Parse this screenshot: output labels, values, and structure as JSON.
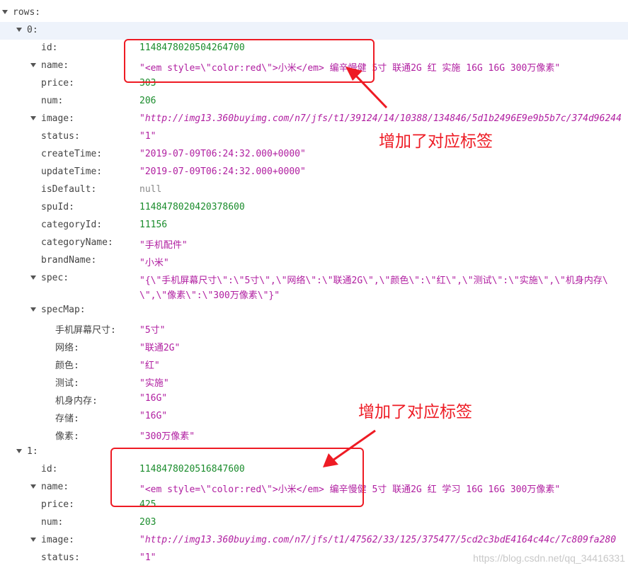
{
  "root_key": "rows:",
  "row0": {
    "index_label": "0:",
    "id_key": "id:",
    "id": "1148478020504264700",
    "name_key": "name:",
    "name": "\"<em style=\\\"color:red\\\">小米</em> 编辛慢健  5寸  联通2G  红  实施  16G  16G  300万像素\"",
    "price_key": "price:",
    "price": "303",
    "num_key": "num:",
    "num": "206",
    "image_key": "image:",
    "image": "\"http://img13.360buyimg.com/n7/jfs/t1/39124/14/10388/134846/5d1b2496E9e9b5b7c/374d96244",
    "status_key": "status:",
    "status": "\"1\"",
    "createTime_key": "createTime:",
    "createTime": "\"2019-07-09T06:24:32.000+0000\"",
    "updateTime_key": "updateTime:",
    "updateTime": "\"2019-07-09T06:24:32.000+0000\"",
    "isDefault_key": "isDefault:",
    "isDefault": "null",
    "spuId_key": "spuId:",
    "spuId": "1148478020420378600",
    "categoryId_key": "categoryId:",
    "categoryId": "11156",
    "categoryName_key": "categoryName:",
    "categoryName": "\"手机配件\"",
    "brandName_key": "brandName:",
    "brandName": "\"小米\"",
    "spec_key": "spec:",
    "spec_line1": "\"{\\\"手机屏幕尺寸\\\":\\\"5寸\\\",\\\"网络\\\":\\\"联通2G\\\",\\\"颜色\\\":\\\"红\\\",\\\"测试\\\":\\\"实施\\\",\\\"机身内存\\",
    "spec_line2": "\\\",\\\"像素\\\":\\\"300万像素\\\"}\"",
    "specMap_key": "specMap:",
    "specMap": [
      {
        "key": "手机屏幕尺寸:",
        "value": "\"5寸\""
      },
      {
        "key": "网络:",
        "value": "\"联通2G\""
      },
      {
        "key": "颜色:",
        "value": "\"红\""
      },
      {
        "key": "测试:",
        "value": "\"实施\""
      },
      {
        "key": "机身内存:",
        "value": "\"16G\""
      },
      {
        "key": "存储:",
        "value": "\"16G\""
      },
      {
        "key": "像素:",
        "value": "\"300万像素\""
      }
    ]
  },
  "row1": {
    "index_label": "1:",
    "id_key": "id:",
    "id": "1148478020516847600",
    "name_key": "name:",
    "name": "\"<em style=\\\"color:red\\\">小米</em> 编辛慢健  5寸  联通2G  红  学习  16G  16G  300万像素\"",
    "price_key": "price:",
    "price": "425",
    "num_key": "num:",
    "num": "203",
    "image_key": "image:",
    "image": "\"http://img13.360buyimg.com/n7/jfs/t1/47562/33/125/375477/5cd2c3bdE4164c44c/7c809fa280",
    "status_key": "status:",
    "status": "\"1\""
  },
  "annotation": {
    "note1": "增加了对应标签",
    "note2": "增加了对应标签",
    "color": "#ee1b24"
  },
  "watermark": "https://blog.csdn.net/qq_34416331",
  "colors": {
    "number": "#1a8c2c",
    "string": "#b01ea0",
    "null": "#888888",
    "key": "#444444",
    "row_highlight": "#eef3fb"
  }
}
